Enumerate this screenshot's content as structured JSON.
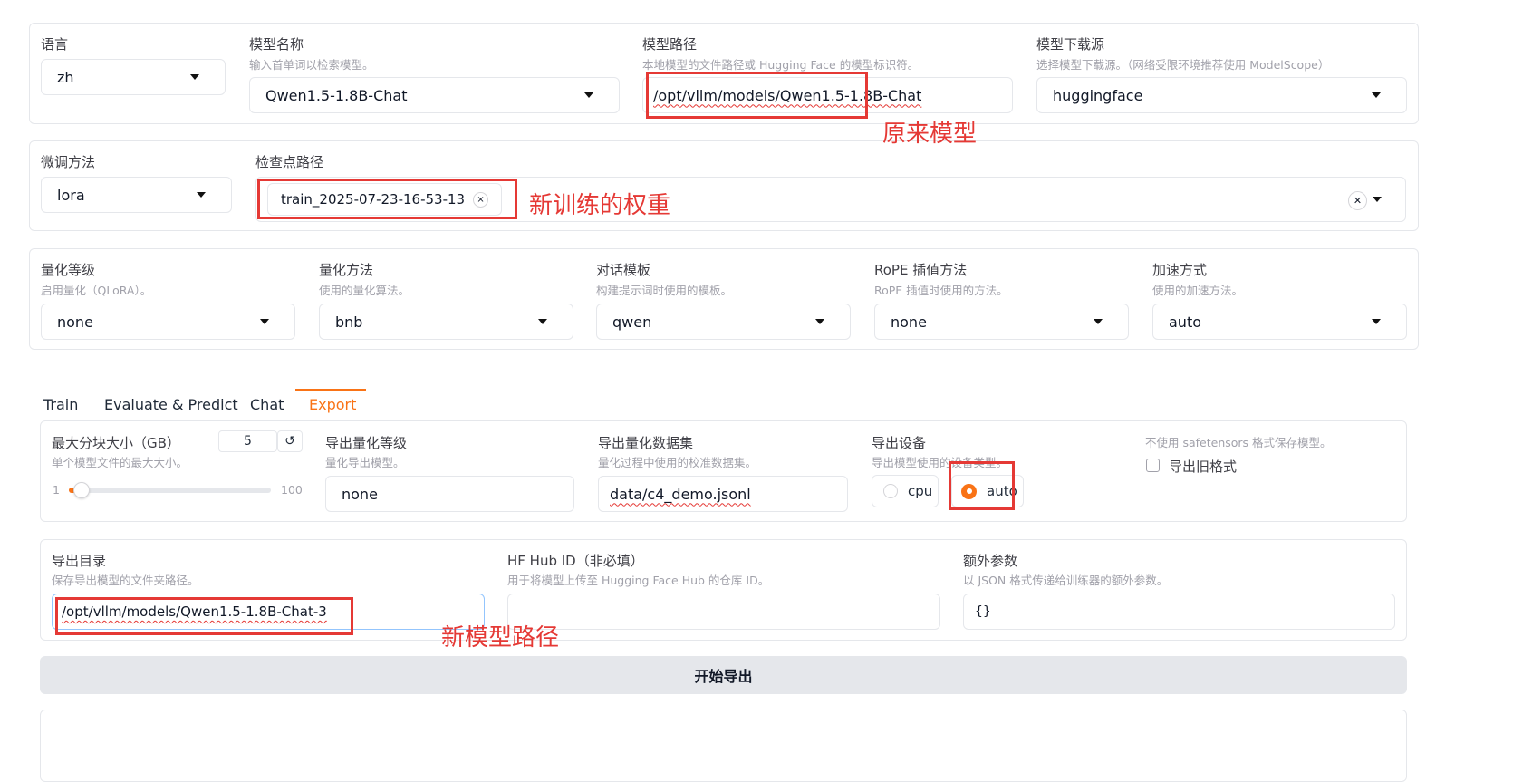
{
  "row1": {
    "lang": {
      "label": "语言",
      "value": "zh"
    },
    "model_name": {
      "label": "模型名称",
      "info": "输入首单词以检索模型。",
      "value": "Qwen1.5-1.8B-Chat"
    },
    "model_path": {
      "label": "模型路径",
      "info": "本地模型的文件路径或 Hugging Face 的模型标识符。",
      "value": "/opt/vllm/models/Qwen1.5-1.8B-Chat"
    },
    "hub": {
      "label": "模型下载源",
      "info": "选择模型下载源。（网络受限环境推荐使用 ModelScope）",
      "value": "huggingface"
    }
  },
  "row2": {
    "finetune": {
      "label": "微调方法",
      "value": "lora"
    },
    "checkpoint": {
      "label": "检查点路径",
      "tag": "train_2025-07-23-16-53-13",
      "tag_close": "×",
      "clear": "✕"
    }
  },
  "row3": {
    "quant_bit": {
      "label": "量化等级",
      "info": "启用量化（QLoRA）。",
      "value": "none"
    },
    "quant_method": {
      "label": "量化方法",
      "info": "使用的量化算法。",
      "value": "bnb"
    },
    "template": {
      "label": "对话模板",
      "info": "构建提示词时使用的模板。",
      "value": "qwen"
    },
    "rope": {
      "label": "RoPE 插值方法",
      "info": "RoPE 插值时使用的方法。",
      "value": "none"
    },
    "booster": {
      "label": "加速方式",
      "info": "使用的加速方法。",
      "value": "auto"
    }
  },
  "tabs": [
    "Train",
    "Evaluate & Predict",
    "Chat",
    "Export"
  ],
  "active_tab": "Export",
  "export": {
    "shard": {
      "label": "最大分块大小（GB）",
      "info": "单个模型文件的最大大小。",
      "value": "5",
      "reset": "↺",
      "min": "1",
      "max": "100",
      "fraction": 0.04
    },
    "quant_bit": {
      "label": "导出量化等级",
      "info": "量化导出模型。",
      "value": "none"
    },
    "quant_dataset": {
      "label": "导出量化数据集",
      "info": "量化过程中使用的校准数据集。",
      "value": "data/c4_demo.jsonl"
    },
    "device": {
      "label": "导出设备",
      "info": "导出模型使用的设备类型。",
      "options": [
        "cpu",
        "auto"
      ],
      "selected": "auto"
    },
    "legacy": {
      "info": "不使用 safetensors 格式保存模型。",
      "label": "导出旧格式",
      "checked": false
    },
    "dir": {
      "label": "导出目录",
      "info": "保存导出模型的文件夹路径。",
      "value": "/opt/vllm/models/Qwen1.5-1.8B-Chat-3"
    },
    "hub_id": {
      "label": "HF Hub ID（非必填）",
      "info": "用于将模型上传至 Hugging Face Hub 的仓库 ID。",
      "value": ""
    },
    "extra": {
      "label": "额外参数",
      "info": "以 JSON 格式传递给训练器的额外参数。",
      "value": "{}"
    },
    "start": "开始导出"
  },
  "annotations": {
    "original": "原来模型",
    "new_weights": "新训练的权重",
    "new_path": "新模型路径"
  },
  "colors": {
    "accent": "#f97316",
    "annotation": "#e53935"
  }
}
